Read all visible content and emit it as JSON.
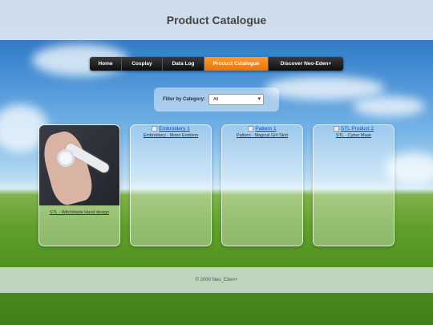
{
  "header": {
    "title": "Product Catalogue"
  },
  "nav": {
    "items": [
      {
        "label": "Home"
      },
      {
        "label": "Cosplay"
      },
      {
        "label": "Data Log"
      },
      {
        "label": "Product Catalogue"
      },
      {
        "label": "Discover Neo-Eden+"
      }
    ],
    "active": "Product Catalogue"
  },
  "filter": {
    "label": "Filter by Category:",
    "selected": "All"
  },
  "products": [
    {
      "image_alt": "",
      "caption": "STL - Witchblade Hand design"
    },
    {
      "image_alt": "Embroidery 1",
      "caption": "Embroidery - Moon Emblem"
    },
    {
      "image_alt": "Pattern 1",
      "caption": "Pattern - Magical Girl Skirt"
    },
    {
      "image_alt": "STL Product 2",
      "caption": "STL - Cyber Mask"
    }
  ],
  "footer": {
    "text": "© 2000 Neo_Eden+"
  },
  "colors": {
    "nav_active": "#f27200",
    "nav_bg": "#111111",
    "link": "#1a3fd6"
  }
}
